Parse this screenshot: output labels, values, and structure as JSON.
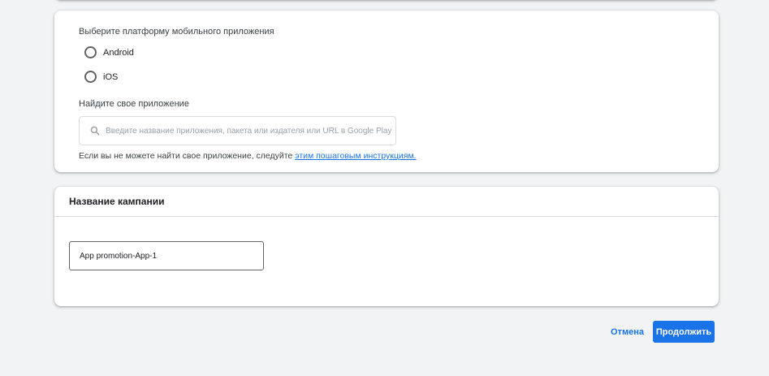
{
  "platform": {
    "label": "Выберите платформу мобильного приложения",
    "options": [
      {
        "label": "Android",
        "selected": false
      },
      {
        "label": "iOS",
        "selected": false
      }
    ]
  },
  "find_app": {
    "label": "Найдите свое приложение",
    "placeholder": "Введите название приложения, пакета или издателя или URL в Google Play",
    "value": "",
    "help_text": "Если вы не можете найти свое приложение, следуйте ",
    "help_link": "этим пошаговым инструкциям."
  },
  "campaign_name": {
    "title": "Название кампании",
    "value": "App promotion-App-1"
  },
  "actions": {
    "cancel_label": "Отмена",
    "continue_label": "Продолжить"
  },
  "colors": {
    "accent": "#1a73e8",
    "background": "#f1f3f4",
    "card": "#ffffff"
  },
  "icons": {
    "search": "search-icon"
  }
}
